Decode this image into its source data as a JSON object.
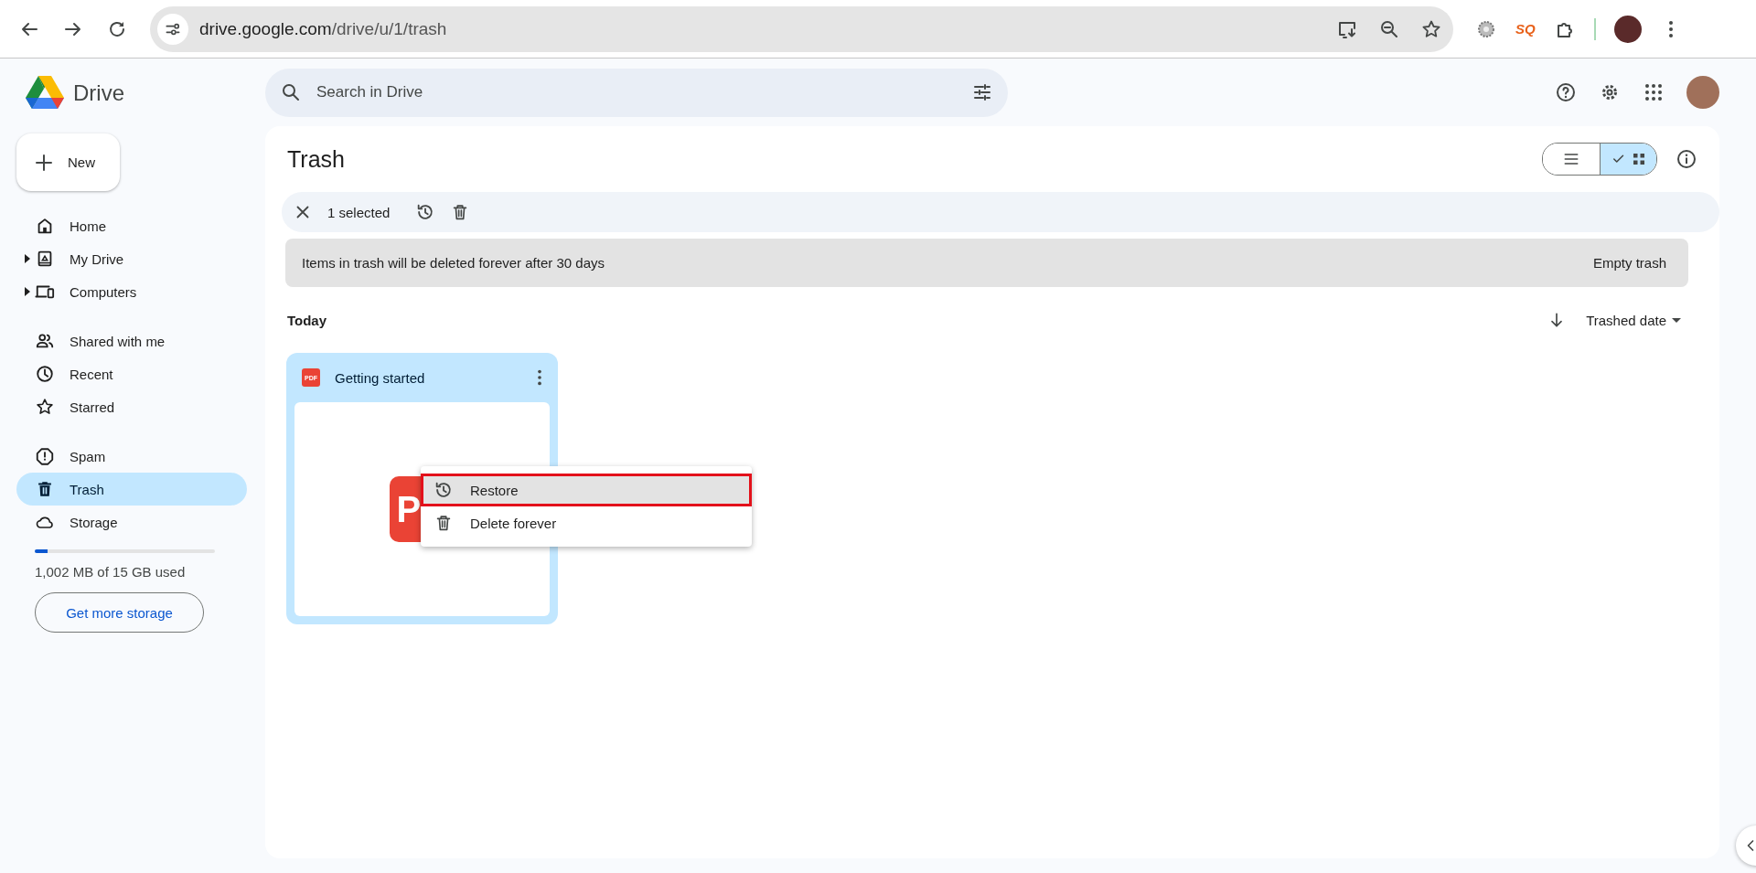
{
  "browser": {
    "url_host": "drive.google.com",
    "url_path": "/drive/u/1/trash",
    "extension_badge": "SQ"
  },
  "app": {
    "name": "Drive"
  },
  "new_button": "New",
  "nav_groups": [
    [
      {
        "label": "Home",
        "expandable": false,
        "selected": false
      },
      {
        "label": "My Drive",
        "expandable": true,
        "selected": false
      },
      {
        "label": "Computers",
        "expandable": true,
        "selected": false
      }
    ],
    [
      {
        "label": "Shared with me",
        "expandable": false,
        "selected": false
      },
      {
        "label": "Recent",
        "expandable": false,
        "selected": false
      },
      {
        "label": "Starred",
        "expandable": false,
        "selected": false
      }
    ],
    [
      {
        "label": "Spam",
        "expandable": false,
        "selected": false
      },
      {
        "label": "Trash",
        "expandable": false,
        "selected": true
      },
      {
        "label": "Storage",
        "expandable": false,
        "selected": false
      }
    ]
  ],
  "storage": {
    "level": 0.07,
    "text": "1,002 MB of 15 GB used",
    "button": "Get more storage"
  },
  "search": {
    "placeholder": "Search in Drive"
  },
  "page_title": "Trash",
  "view_toggle": [
    {
      "kind": "list",
      "selected": false
    },
    {
      "kind": "grid",
      "selected": true
    }
  ],
  "selection_bar": {
    "count": "1 selected"
  },
  "banner": {
    "text": "Items in trash will be deleted forever after 30 days",
    "action": "Empty trash"
  },
  "section_title": "Today",
  "sort": {
    "label": "Trashed date"
  },
  "files": [
    {
      "name": "Getting started",
      "badge": "PDF",
      "thumb_badge": "P",
      "selected": true
    }
  ],
  "context_menu": [
    {
      "label": "Restore",
      "selected": true
    },
    {
      "label": "Delete forever",
      "selected": false
    }
  ]
}
